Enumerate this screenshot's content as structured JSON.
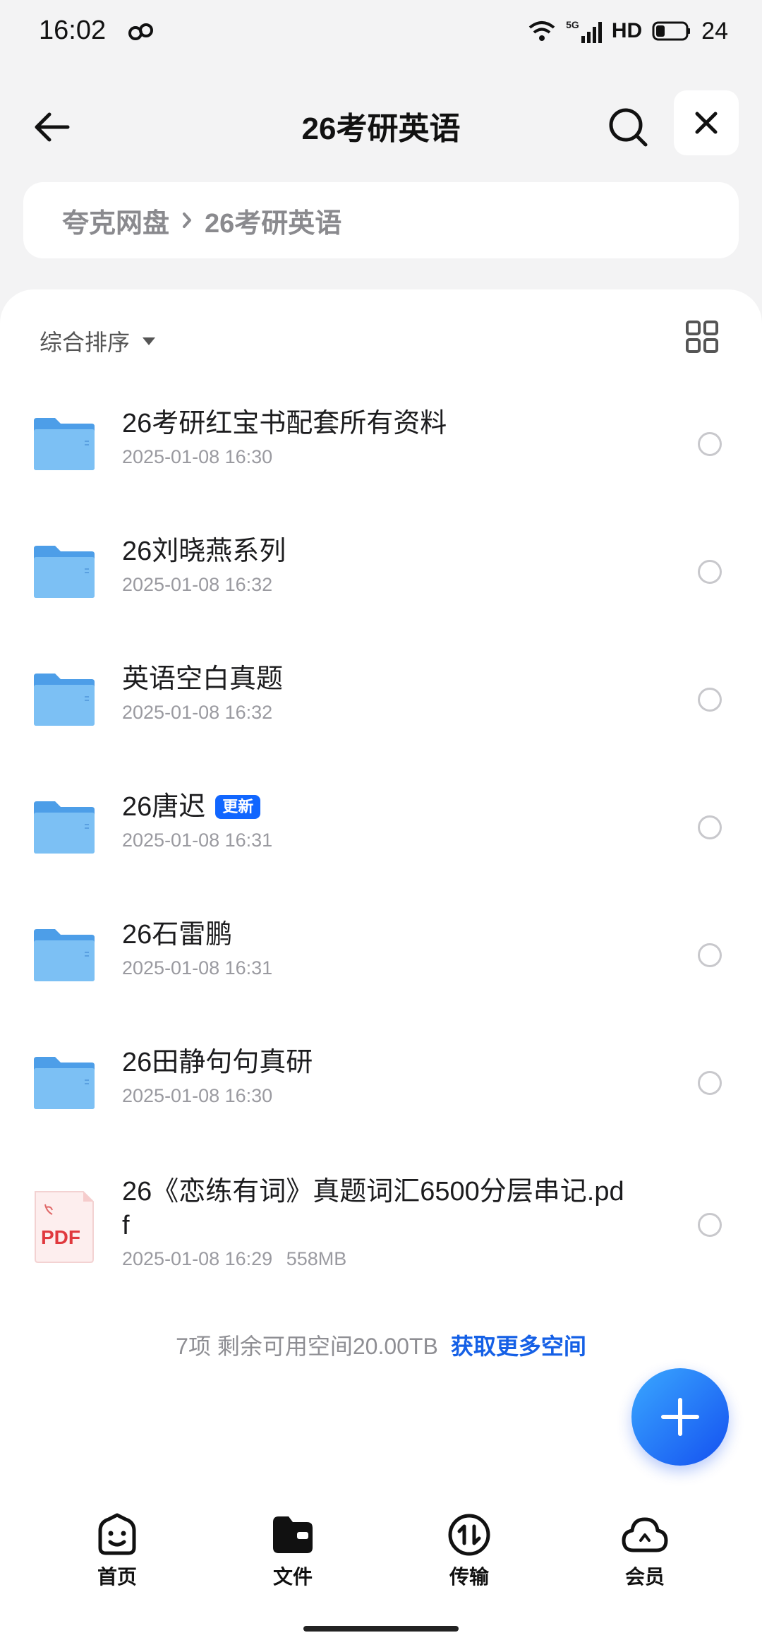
{
  "status_bar": {
    "time": "16:02",
    "network": "5G",
    "hd": "HD",
    "battery": "24"
  },
  "header": {
    "title": "26考研英语"
  },
  "breadcrumb": {
    "root": "夸克网盘",
    "current": "26考研英语"
  },
  "sort": {
    "label": "综合排序"
  },
  "files": [
    {
      "name": "26考研红宝书配套所有资料",
      "date": "2025-01-08 16:30",
      "type": "folder"
    },
    {
      "name": "26刘晓燕系列",
      "date": "2025-01-08 16:32",
      "type": "folder"
    },
    {
      "name": "英语空白真题",
      "date": "2025-01-08 16:32",
      "type": "folder"
    },
    {
      "name": "26唐迟",
      "date": "2025-01-08 16:31",
      "type": "folder",
      "badge": "更新"
    },
    {
      "name": "26石雷鹏",
      "date": "2025-01-08 16:31",
      "type": "folder"
    },
    {
      "name": "26田静句句真研",
      "date": "2025-01-08 16:30",
      "type": "folder"
    },
    {
      "name": "26《恋练有词》真题词汇6500分层串记.pdf",
      "date": "2025-01-08 16:29",
      "size": "558MB",
      "type": "pdf"
    }
  ],
  "pdf_icon_label": "PDF",
  "footer": {
    "info": "7项 剩余可用空间20.00TB",
    "link": "获取更多空间"
  },
  "nav": {
    "home": "首页",
    "files": "文件",
    "transfer": "传输",
    "member": "会员"
  },
  "colors": {
    "accent": "#1560e6",
    "folder": "#5aaaf0",
    "badge": "#1166ff"
  }
}
